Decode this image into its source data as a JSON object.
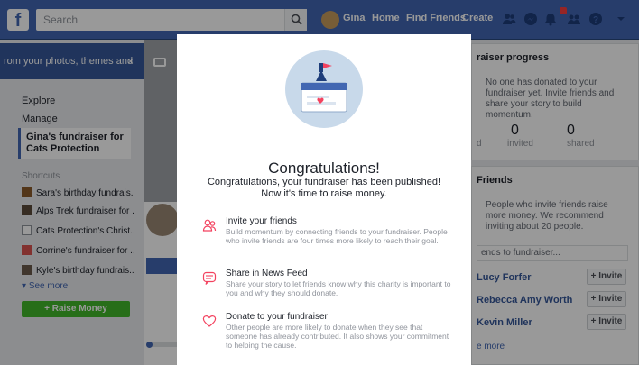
{
  "topbar": {
    "logo": "f",
    "search_placeholder": "Search",
    "user_name": "Gina",
    "nav_home": "Home",
    "nav_find_friends": "Find Friends",
    "nav_create": "Create"
  },
  "left_sidebar": {
    "banner_text": "rom your photos, themes and",
    "banner_close": "×",
    "explore": "Explore",
    "manage": "Manage",
    "active_item": "Gina's fundraiser for Cats Protection",
    "shortcuts_heading": "Shortcuts",
    "shortcuts": [
      {
        "label": "Sara's birthday fundrais...",
        "color": "#8b5a2b"
      },
      {
        "label": "Alps Trek fundraiser for ...",
        "color": "#5b4a3a"
      },
      {
        "label": "Cats Protection's Christ...",
        "color": "#ffffff"
      },
      {
        "label": "Corrine's fundraiser for ...",
        "color": "#d9534f"
      },
      {
        "label": "Kyle's birthday fundrais...",
        "color": "#6b5b4b"
      }
    ],
    "see_more": "See more",
    "raise_money": "+  Raise Money"
  },
  "right_column": {
    "progress_title": "raiser progress",
    "progress_text": "No one has donated to your fundraiser yet. Invite friends and share your story to build momentum.",
    "stat_invited_value": "0",
    "stat_invited_label": "invited",
    "stat_shared_value": "0",
    "stat_shared_label": "shared",
    "stat_left_label": "d",
    "friends_title": "Friends",
    "friends_text": "People who invite friends raise more money. We recommend inviting about 20 people.",
    "invite_input": "ends to fundraiser...",
    "friends": [
      {
        "name": "Lucy Forfer",
        "button": "+ Invite"
      },
      {
        "name": "Rebecca Amy Worth",
        "button": "+ Invite"
      },
      {
        "name": "Kevin Miller",
        "button": "+ Invite"
      }
    ],
    "see_more": "e more"
  },
  "modal": {
    "title": "Congratulations!",
    "subtitle": "Congratulations, your fundraiser has been published! Now it's time to raise money.",
    "steps": [
      {
        "icon": "friends-icon",
        "title": "Invite your friends",
        "desc": "Build momentum by connecting friends to your fundraiser. People who invite friends are four times more likely to reach their goal."
      },
      {
        "icon": "news-feed-icon",
        "title": "Share in News Feed",
        "desc": "Share your story to let friends know why this charity is important to you and why they should donate."
      },
      {
        "icon": "heart-icon",
        "title": "Donate to your fundraiser",
        "desc": "Other people are more likely to donate when they see that someone has already contributed. It also shows your commitment to helping the cause."
      }
    ]
  },
  "colors": {
    "brand_blue": "#4267b2",
    "accent_pink": "#f3425f",
    "raise_green": "#42b72a"
  }
}
